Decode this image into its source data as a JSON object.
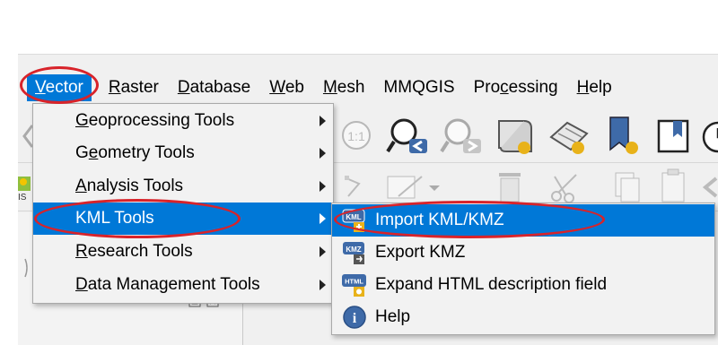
{
  "menubar": {
    "items": [
      {
        "label": "Vector",
        "u": "V",
        "rest": "ector"
      },
      {
        "label": "Raster",
        "u": "R",
        "rest": "aster"
      },
      {
        "label": "Database",
        "u": "D",
        "rest": "atabase"
      },
      {
        "label": "Web",
        "u": "W",
        "rest": "eb"
      },
      {
        "label": "Mesh",
        "u": "M",
        "rest": "esh"
      },
      {
        "label": "MMQGIS",
        "u": "",
        "rest": "MMQGIS"
      },
      {
        "label": "Processing",
        "pre": "Pro",
        "u": "c",
        "rest": "essing"
      },
      {
        "label": "Help",
        "u": "H",
        "rest": "elp"
      }
    ]
  },
  "vector_menu": {
    "items": [
      {
        "label": "Geoprocessing Tools",
        "u": "G",
        "rest": "eoprocessing Tools"
      },
      {
        "label": "Geometry Tools",
        "pre": "G",
        "u": "e",
        "rest": "ometry Tools"
      },
      {
        "label": "Analysis Tools",
        "u": "A",
        "rest": "nalysis Tools"
      },
      {
        "label": "KML Tools",
        "u": "",
        "rest": "KML Tools"
      },
      {
        "label": "Research Tools",
        "u": "R",
        "rest": "esearch Tools"
      },
      {
        "label": "Data Management Tools",
        "u": "D",
        "rest": "ata Management Tools"
      }
    ]
  },
  "kml_submenu": {
    "items": [
      {
        "label": "Import KML/KMZ",
        "icon": "kml-import-icon",
        "badge": "KML"
      },
      {
        "label": "Export KMZ",
        "icon": "kmz-export-icon",
        "badge": "KMZ"
      },
      {
        "label": "Expand HTML description field",
        "icon": "html-expand-icon",
        "badge": "HTML"
      },
      {
        "label": "Help",
        "icon": "info-icon",
        "badge": "i"
      }
    ]
  },
  "toolbar": {
    "zoom_badge": "1:1"
  },
  "colors": {
    "highlight": "#0078d7",
    "annotation": "#d8232a"
  }
}
